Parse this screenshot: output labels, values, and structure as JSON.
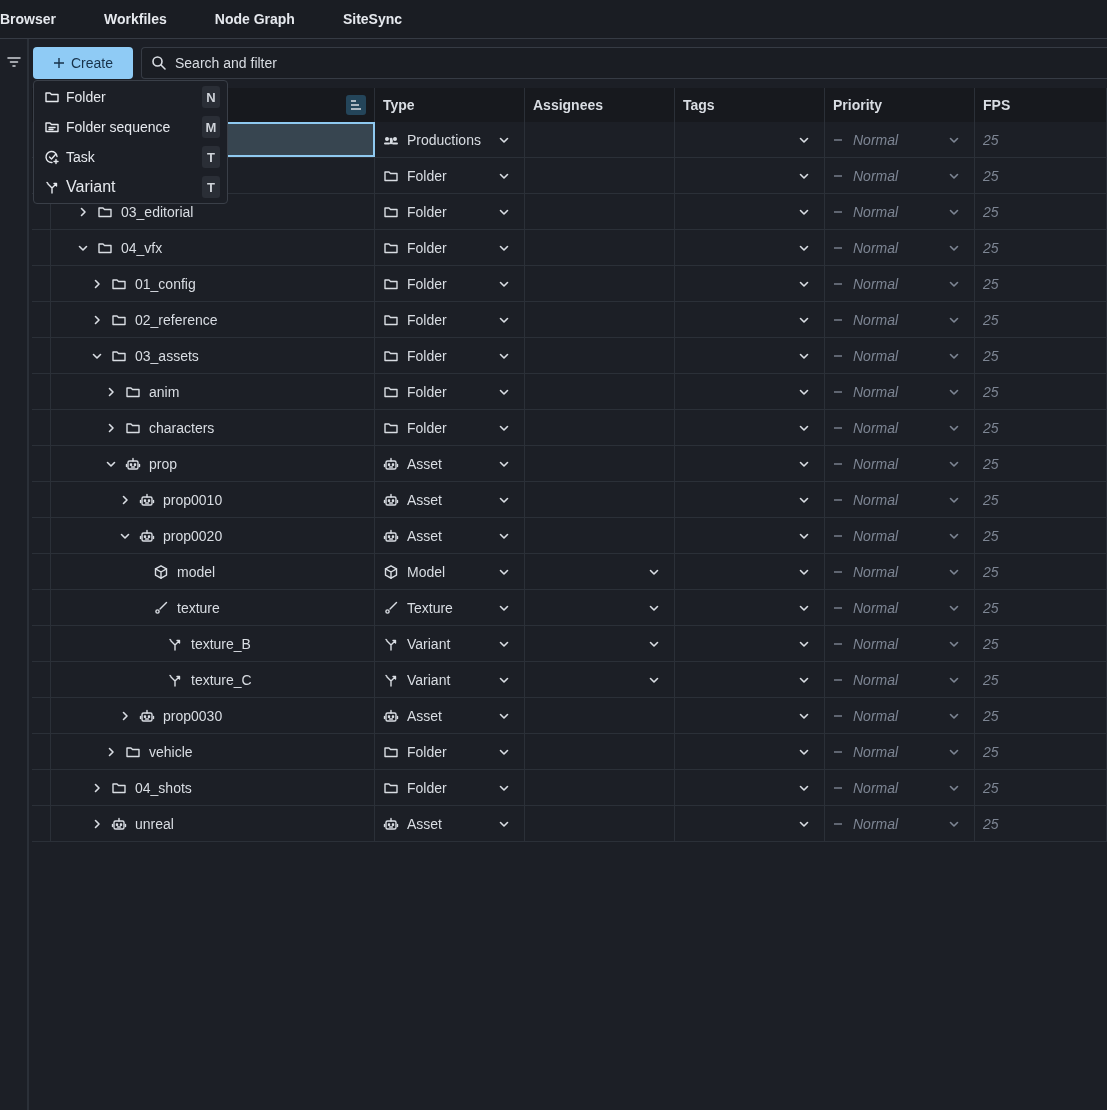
{
  "top_tabs": [
    {
      "label": "Browser",
      "selected": false
    },
    {
      "label": "Workfiles",
      "selected": false
    },
    {
      "label": "Node Graph",
      "selected": false
    },
    {
      "label": "SiteSync",
      "selected": false
    }
  ],
  "toolbar": {
    "create_button": "Create",
    "search": {
      "placeholder": "Search and filter"
    }
  },
  "create_menu": [
    {
      "kind": "folder",
      "label": "Folder",
      "shortcut": "N"
    },
    {
      "kind": "sequence",
      "label": "Folder sequence",
      "shortcut": "M"
    },
    {
      "kind": "task",
      "label": "Task",
      "shortcut": "T"
    },
    {
      "kind": "variant",
      "label": "Variant",
      "shortcut": "T"
    }
  ],
  "table": {
    "columns": [
      "Type",
      "Assignees",
      "Tags",
      "Priority",
      "FPS"
    ],
    "rows": [
      {
        "kind": "productions",
        "type": "Productions",
        "selected": true,
        "assignable": false,
        "priority": "Normal",
        "fps": "25",
        "children": [
          {
            "kind": "folder",
            "type": "Folder",
            "selected": false,
            "assignable": false,
            "priority": "Normal",
            "fps": "25"
          },
          {
            "name": "03_editorial",
            "kind": "folder",
            "type": "Folder",
            "expanded": false,
            "selected": false,
            "assignable": false,
            "priority": "Normal",
            "fps": "25"
          },
          {
            "name": "04_vfx",
            "kind": "folder",
            "type": "Folder",
            "expanded": true,
            "selected": false,
            "assignable": false,
            "priority": "Normal",
            "fps": "25",
            "children": [
              {
                "name": "01_config",
                "kind": "folder",
                "type": "Folder",
                "expanded": false,
                "selected": false,
                "assignable": false,
                "priority": "Normal",
                "fps": "25"
              },
              {
                "name": "02_reference",
                "kind": "folder",
                "type": "Folder",
                "expanded": false,
                "selected": false,
                "assignable": false,
                "priority": "Normal",
                "fps": "25"
              },
              {
                "name": "03_assets",
                "kind": "folder",
                "type": "Folder",
                "expanded": true,
                "selected": false,
                "assignable": false,
                "priority": "Normal",
                "fps": "25",
                "children": [
                  {
                    "name": "anim",
                    "kind": "folder",
                    "type": "Folder",
                    "expanded": false,
                    "selected": false,
                    "assignable": false,
                    "priority": "Normal",
                    "fps": "25"
                  },
                  {
                    "name": "characters",
                    "kind": "folder",
                    "type": "Folder",
                    "expanded": false,
                    "selected": false,
                    "assignable": false,
                    "priority": "Normal",
                    "fps": "25"
                  },
                  {
                    "name": "prop",
                    "kind": "asset",
                    "type": "Asset",
                    "expanded": true,
                    "selected": false,
                    "assignable": false,
                    "priority": "Normal",
                    "fps": "25",
                    "children": [
                      {
                        "name": "prop0010",
                        "kind": "asset",
                        "type": "Asset",
                        "expanded": false,
                        "selected": false,
                        "assignable": false,
                        "priority": "Normal",
                        "fps": "25"
                      },
                      {
                        "name": "prop0020",
                        "kind": "asset",
                        "type": "Asset",
                        "expanded": true,
                        "selected": false,
                        "assignable": false,
                        "priority": "Normal",
                        "fps": "25",
                        "children": [
                          {
                            "name": "model",
                            "kind": "model",
                            "type": "Model",
                            "selected": false,
                            "assignable": true,
                            "priority": "Normal",
                            "fps": "25"
                          },
                          {
                            "name": "texture",
                            "kind": "texture",
                            "type": "Texture",
                            "selected": false,
                            "assignable": true,
                            "priority": "Normal",
                            "fps": "25",
                            "children": [
                              {
                                "name": "texture_B",
                                "kind": "variant",
                                "type": "Variant",
                                "selected": false,
                                "assignable": true,
                                "priority": "Normal",
                                "fps": "25"
                              },
                              {
                                "name": "texture_C",
                                "kind": "variant",
                                "type": "Variant",
                                "selected": false,
                                "assignable": true,
                                "priority": "Normal",
                                "fps": "25"
                              }
                            ]
                          }
                        ]
                      },
                      {
                        "name": "prop0030",
                        "kind": "asset",
                        "type": "Asset",
                        "expanded": false,
                        "selected": false,
                        "assignable": false,
                        "priority": "Normal",
                        "fps": "25"
                      }
                    ]
                  },
                  {
                    "name": "vehicle",
                    "kind": "folder",
                    "type": "Folder",
                    "expanded": false,
                    "selected": false,
                    "assignable": false,
                    "priority": "Normal",
                    "fps": "25"
                  }
                ]
              },
              {
                "name": "04_shots",
                "kind": "folder",
                "type": "Folder",
                "expanded": false,
                "selected": false,
                "assignable": false,
                "priority": "Normal",
                "fps": "25"
              },
              {
                "name": "unreal",
                "kind": "asset",
                "type": "Asset",
                "expanded": false,
                "selected": false,
                "assignable": false,
                "priority": "Normal",
                "fps": "25"
              }
            ]
          }
        ]
      }
    ]
  }
}
